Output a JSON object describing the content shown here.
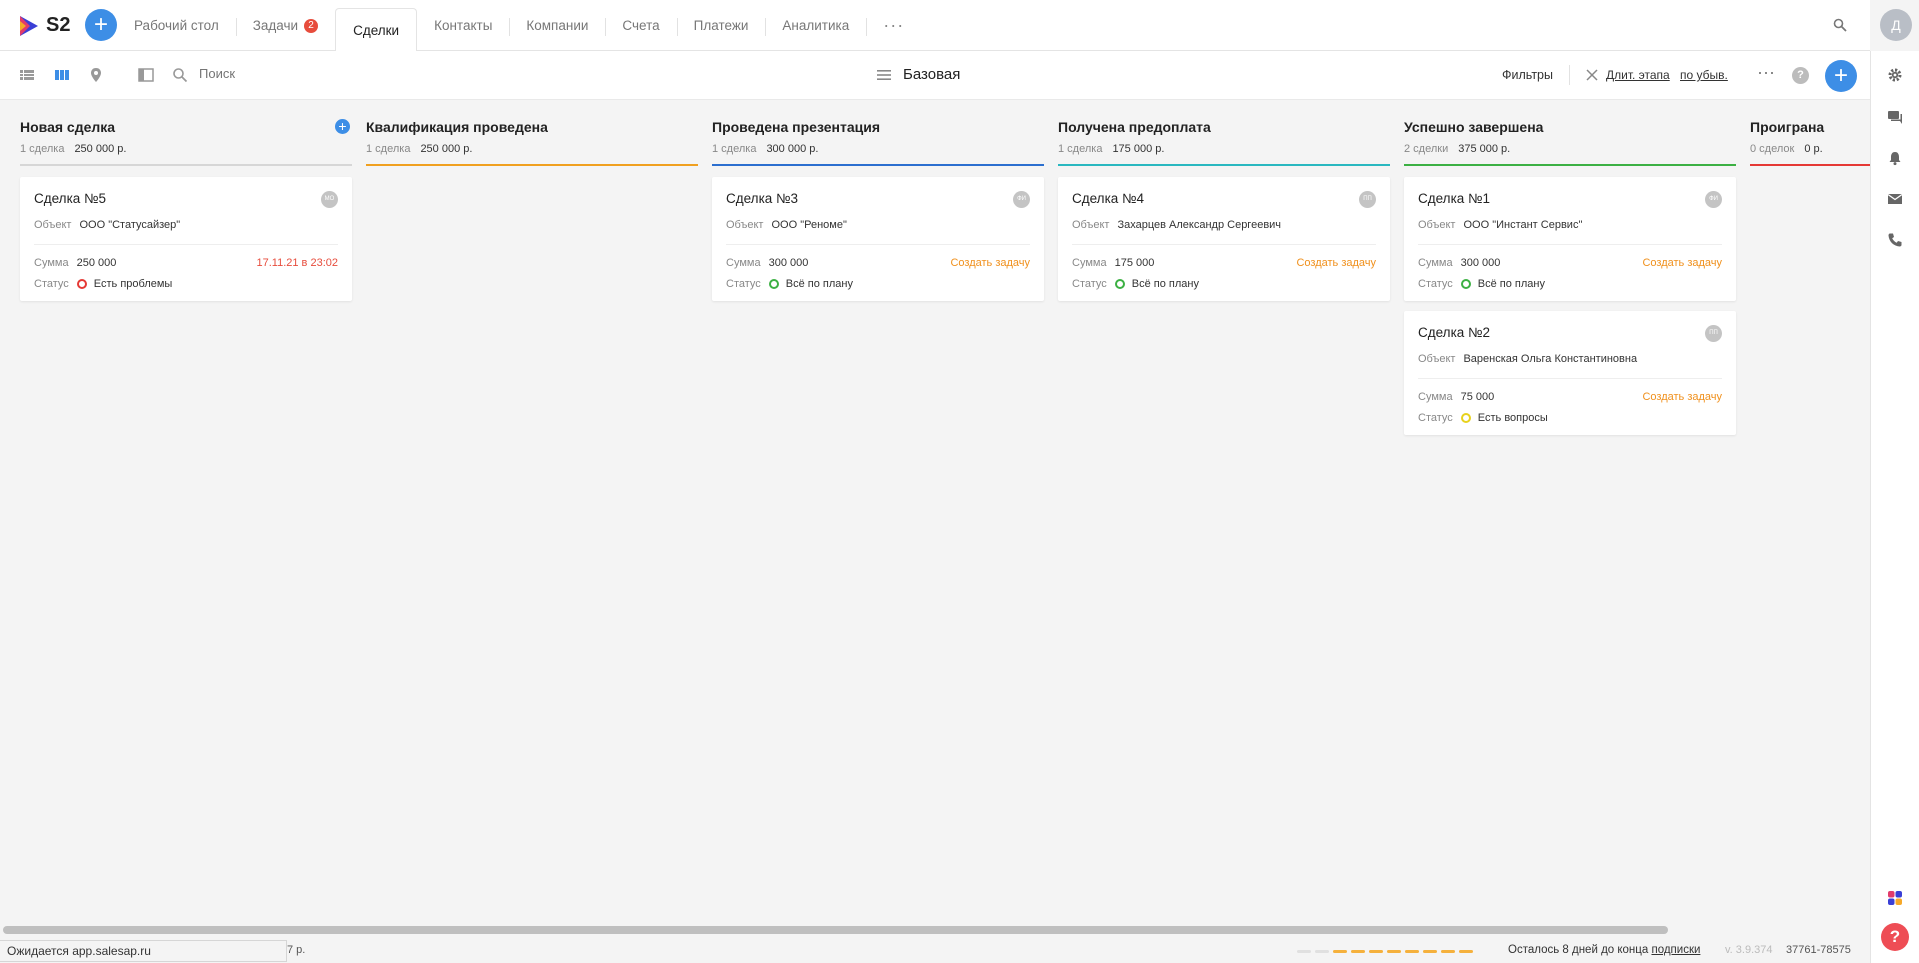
{
  "app": {
    "logo_text": "S2",
    "user_initial": "Д"
  },
  "nav": {
    "tabs": [
      {
        "label": "Рабочий стол"
      },
      {
        "label": "Задачи",
        "badge": "2"
      },
      {
        "label": "Сделки",
        "active": true
      },
      {
        "label": "Контакты"
      },
      {
        "label": "Компании"
      },
      {
        "label": "Счета"
      },
      {
        "label": "Платежи"
      },
      {
        "label": "Аналитика"
      }
    ],
    "more": "···"
  },
  "toolbar": {
    "search_placeholder": "Поиск",
    "view_name": "Базовая",
    "filters_label": "Фильтры",
    "sort_field": "Длит. этапа",
    "sort_order": "по убыв.",
    "more": "···"
  },
  "colors": {
    "accent": "#3d8ee6",
    "danger": "#e74c3c",
    "stage_new": "#d6d6d6",
    "stage_qualified": "#f0a020",
    "stage_presentation": "#2c6fcf",
    "stage_prepaid": "#2ab8c0",
    "stage_won": "#3cb043",
    "stage_lost": "#e53935"
  },
  "board": {
    "columns": [
      {
        "title": "Новая сделка",
        "count": "1 сделка",
        "sum": "250 000 р.",
        "cards": [
          {
            "title": "Сделка №5",
            "avatar": "МО",
            "object_label": "Объект",
            "object": "ООО \"Статусайзер\"",
            "sum_label": "Сумма",
            "sum": "250 000",
            "action": "17.11.21 в 23:02",
            "status_label": "Статус",
            "status": "Есть проблемы",
            "status_color": "#e53935"
          }
        ]
      },
      {
        "title": "Квалификация проведена",
        "count": "1 сделка",
        "sum": "250 000 р.",
        "cards": []
      },
      {
        "title": "Проведена презентация",
        "count": "1 сделка",
        "sum": "300 000 р.",
        "cards": [
          {
            "title": "Сделка №3",
            "avatar": "ФИ",
            "object_label": "Объект",
            "object": "ООО \"Реноме\"",
            "sum_label": "Сумма",
            "sum": "300 000",
            "action": "Создать задачу",
            "status_label": "Статус",
            "status": "Всё по плану",
            "status_color": "#3cb043"
          }
        ]
      },
      {
        "title": "Получена предоплата",
        "count": "1 сделка",
        "sum": "175 000 р.",
        "cards": [
          {
            "title": "Сделка №4",
            "avatar": "ПП",
            "object_label": "Объект",
            "object": "Захарцев Александр Сергеевич",
            "sum_label": "Сумма",
            "sum": "175 000",
            "action": "Создать задачу",
            "status_label": "Статус",
            "status": "Всё по плану",
            "status_color": "#3cb043"
          }
        ]
      },
      {
        "title": "Успешно завершена",
        "count": "2 сделки",
        "sum": "375 000 р.",
        "cards": [
          {
            "title": "Сделка №1",
            "avatar": "ФИ",
            "object_label": "Объект",
            "object": "ООО \"Инстант Сервис\"",
            "sum_label": "Сумма",
            "sum": "300 000",
            "action": "Создать задачу",
            "status_label": "Статус",
            "status": "Всё по плану",
            "status_color": "#3cb043"
          },
          {
            "title": "Сделка №2",
            "avatar": "ПП",
            "object_label": "Объект",
            "object": "Варенская Ольга Константиновна",
            "sum_label": "Сумма",
            "sum": "75 000",
            "action": "Создать задачу",
            "status_label": "Статус",
            "status": "Есть вопросы",
            "status_color": "#e8d21d"
          }
        ]
      },
      {
        "title": "Проиграна",
        "count": "0 сделок",
        "sum": "0 р.",
        "cards": []
      }
    ]
  },
  "footer": {
    "loading_text": "Ожидается app.salesap.ru",
    "truncated_total": "7 р.",
    "trial_text": "Осталось 8 дней до конца",
    "trial_link": "подписки",
    "version": "v. 3.9.374",
    "account_id": "37761-78575"
  }
}
